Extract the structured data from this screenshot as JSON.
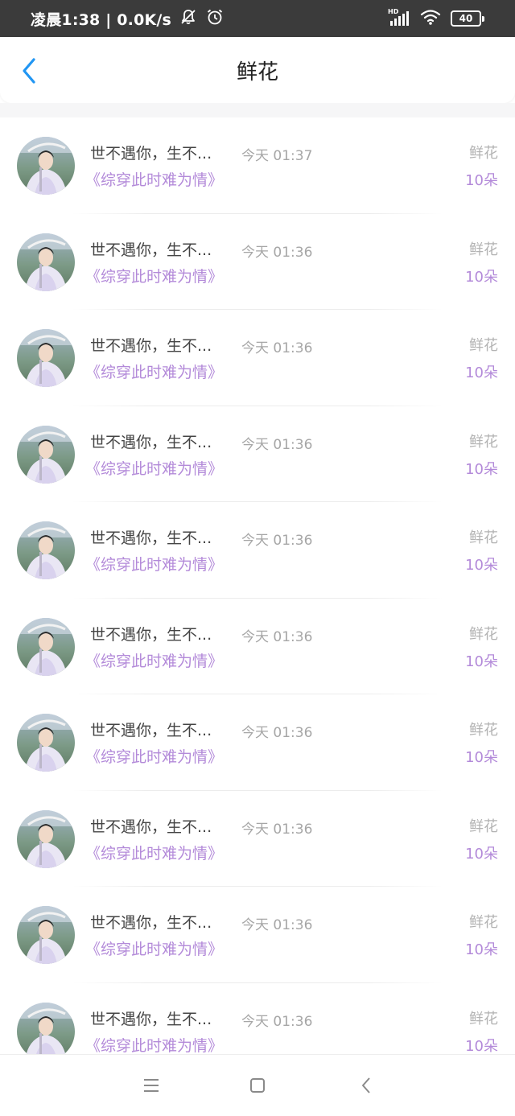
{
  "status_bar": {
    "time_text": "凌晨1:38 | 0.0K/s",
    "network_label": "HD",
    "battery_level": "40",
    "icons": [
      "mute-bell-icon",
      "alarm-icon",
      "signal-icon",
      "wifi-icon",
      "battery-icon"
    ]
  },
  "header": {
    "title": "鲜花",
    "back_icon": "chevron-left-icon",
    "accent_color": "#2196f3"
  },
  "list": {
    "items": [
      {
        "name": "世不遇你，生不...",
        "time": "今天 01:37",
        "book": "《综穿此时难为情》",
        "gift_type": "鲜花",
        "gift_count": "10朵"
      },
      {
        "name": "世不遇你，生不...",
        "time": "今天 01:36",
        "book": "《综穿此时难为情》",
        "gift_type": "鲜花",
        "gift_count": "10朵"
      },
      {
        "name": "世不遇你，生不...",
        "time": "今天 01:36",
        "book": "《综穿此时难为情》",
        "gift_type": "鲜花",
        "gift_count": "10朵"
      },
      {
        "name": "世不遇你，生不...",
        "time": "今天 01:36",
        "book": "《综穿此时难为情》",
        "gift_type": "鲜花",
        "gift_count": "10朵"
      },
      {
        "name": "世不遇你，生不...",
        "time": "今天 01:36",
        "book": "《综穿此时难为情》",
        "gift_type": "鲜花",
        "gift_count": "10朵"
      },
      {
        "name": "世不遇你，生不...",
        "time": "今天 01:36",
        "book": "《综穿此时难为情》",
        "gift_type": "鲜花",
        "gift_count": "10朵"
      },
      {
        "name": "世不遇你，生不...",
        "time": "今天 01:36",
        "book": "《综穿此时难为情》",
        "gift_type": "鲜花",
        "gift_count": "10朵"
      },
      {
        "name": "世不遇你，生不...",
        "time": "今天 01:36",
        "book": "《综穿此时难为情》",
        "gift_type": "鲜花",
        "gift_count": "10朵"
      },
      {
        "name": "世不遇你，生不...",
        "time": "今天 01:36",
        "book": "《综穿此时难为情》",
        "gift_type": "鲜花",
        "gift_count": "10朵"
      },
      {
        "name": "世不遇你，生不...",
        "time": "今天 01:36",
        "book": "《综穿此时难为情》",
        "gift_type": "鲜花",
        "gift_count": "10朵"
      }
    ],
    "book_color": "#b38ad9",
    "meta_color": "#a6a6a6"
  },
  "nav_bar": {
    "icons": [
      "menu-icon",
      "home-square-icon",
      "back-triangle-icon"
    ]
  }
}
